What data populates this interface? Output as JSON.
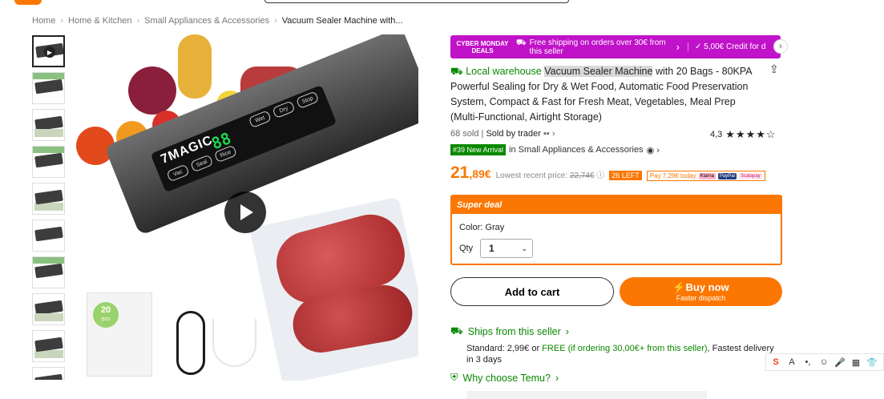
{
  "breadcrumb": [
    "Home",
    "Home & Kitchen",
    "Small Appliances & Accessories",
    "Vacuum Sealer Machine with..."
  ],
  "gallery": {
    "thumbnail_count": 10,
    "hero": {
      "brand": "7MAGIC",
      "display_digits": "88",
      "buttons": [
        "Vac",
        "Seal",
        "Rice",
        "Wet",
        "Dry",
        "Stop"
      ],
      "bags_badge": "20",
      "bags_badge_unit": "pcs"
    }
  },
  "promo": {
    "cyber_monday": "CYBER MONDAY DEALS",
    "shipping": "Free shipping on orders over 30€ from this seller",
    "credit": "5,00€ Credit for d"
  },
  "title": {
    "local": "Local warehouse",
    "highlight": "Vacuum Sealer Machine",
    "rest": " with 20 Bags - 80KPA Powerful Sealing for Dry & Wet Food, Automatic Food Preservation System, Compact & Fast for Fresh Meat, Vegetables, Meal Prep (Multi-Functional, Airtight Storage)"
  },
  "seller": {
    "sold": "68 sold",
    "sold_by": "Sold by trader"
  },
  "rating": {
    "value": "4,3",
    "stars": "★★★★☆"
  },
  "rank": {
    "tag": "#39 New Arrival",
    "category": "in Small Appliances & Accessories"
  },
  "price": {
    "main": "21",
    "cents": ",89€",
    "lowest_label": "Lowest recent price:",
    "lowest_value": "22,74€",
    "left": "26 LEFT",
    "pay": "Pay 7,29€ today",
    "pay_methods": [
      "Klarna",
      "PayPal",
      "Scalapay"
    ]
  },
  "deal": {
    "header": "Super deal",
    "color_label": "Color: Gray",
    "qty_label": "Qty",
    "qty_value": "1"
  },
  "buttons": {
    "add_to_cart": "Add to cart",
    "buy_now": "Buy now",
    "buy_now_sub": "Faster dispatch"
  },
  "shipping": {
    "title": "Ships from this seller",
    "standard_prefix": "Standard: 2,99€ or ",
    "free": "FREE (if ordering 30,00€+ from this seller)",
    "standard_suffix": ", Fastest delivery in 3 days"
  },
  "why": "Why choose Temu?",
  "ime_toolbar": [
    "S",
    "A",
    "•,",
    "☺",
    "🎤",
    "▦",
    "👕"
  ],
  "colors": {
    "accent": "#fb7701",
    "green": "#0a8800",
    "promo": "#c012c9"
  }
}
